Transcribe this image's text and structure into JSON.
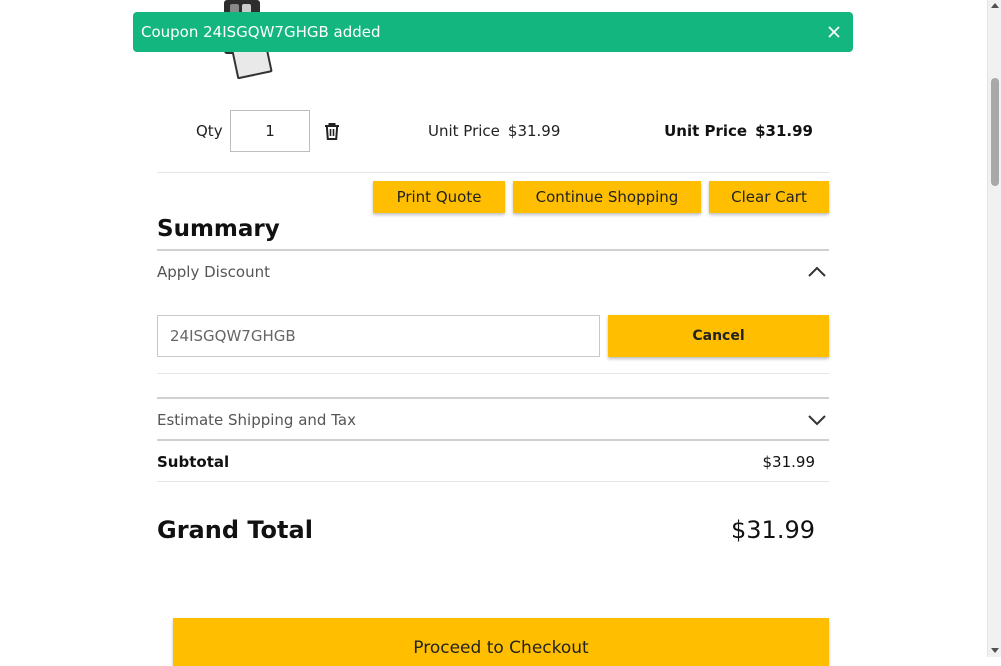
{
  "toast": {
    "message": "Coupon 24ISGQW7GHGB added",
    "color": "#13b67f"
  },
  "cart_item": {
    "qty_label": "Qty",
    "qty_value": "1",
    "unit_price_label": "Unit Price",
    "unit_price_value": "$31.99",
    "row_total_label": "Unit Price",
    "row_total_value": "$31.99"
  },
  "actions": {
    "print_quote": "Print Quote",
    "continue_shopping": "Continue Shopping",
    "clear_cart": "Clear Cart"
  },
  "summary": {
    "title": "Summary",
    "apply_discount": {
      "title": "Apply Discount",
      "expanded": true,
      "coupon_value": "24ISGQW7GHGB",
      "cancel_label": "Cancel"
    },
    "estimate_shipping": {
      "title": "Estimate Shipping and Tax",
      "expanded": false
    },
    "subtotal_label": "Subtotal",
    "subtotal_value": "$31.99",
    "grand_total_label": "Grand Total",
    "grand_total_value": "$31.99"
  },
  "checkout": {
    "label": "Proceed to Checkout"
  },
  "colors": {
    "accent": "#ffbf00",
    "success": "#13b67f"
  },
  "icons": [
    "close-icon",
    "trash-icon",
    "chevron-up-icon",
    "chevron-down-icon"
  ]
}
